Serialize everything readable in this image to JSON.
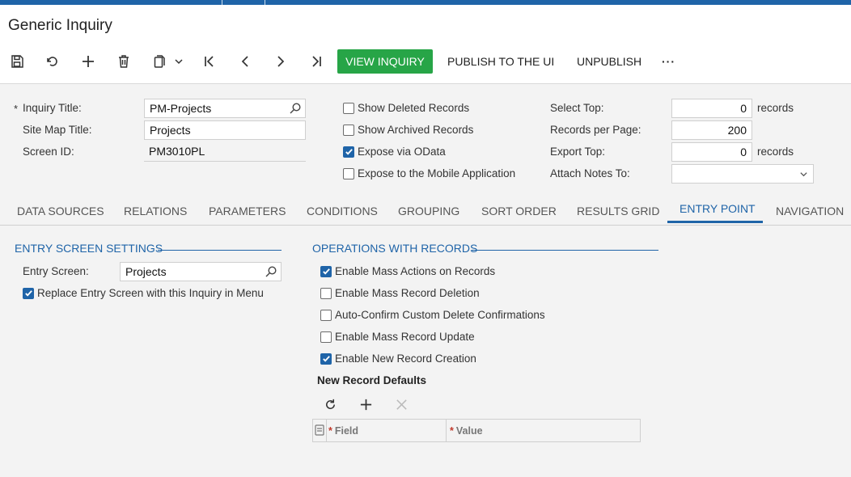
{
  "title": "Generic Inquiry",
  "toolbar": {
    "icons": [
      "save-icon",
      "undo-icon",
      "add-icon",
      "delete-icon",
      "copy-paste-icon",
      "first-record-icon",
      "previous-record-icon",
      "next-record-icon",
      "last-record-icon"
    ],
    "view_inquiry": "VIEW INQUIRY",
    "publish": "PUBLISH TO THE UI",
    "unpublish": "UNPUBLISH",
    "more": "···",
    "accent": "#27a547"
  },
  "form": {
    "required_mark": "*",
    "inquiry_title_label": "Inquiry Title:",
    "inquiry_title_value": "PM-Projects",
    "site_map_title_label": "Site Map Title:",
    "site_map_title_value": "Projects",
    "screen_id_label": "Screen ID:",
    "screen_id_value": "PM3010PL",
    "show_deleted": {
      "label": "Show Deleted Records",
      "checked": false
    },
    "show_archived": {
      "label": "Show Archived Records",
      "checked": false
    },
    "expose_odata": {
      "label": "Expose via OData",
      "checked": true
    },
    "expose_mobile": {
      "label": "Expose to the Mobile Application",
      "checked": false
    },
    "select_top_label": "Select Top:",
    "select_top_value": "0",
    "select_top_unit": "records",
    "records_per_page_label": "Records per Page:",
    "records_per_page_value": "200",
    "export_top_label": "Export Top:",
    "export_top_value": "0",
    "export_top_unit": "records",
    "attach_notes_label": "Attach Notes To:",
    "attach_notes_value": ""
  },
  "tabs": [
    "DATA SOURCES",
    "RELATIONS",
    "PARAMETERS",
    "CONDITIONS",
    "GROUPING",
    "SORT ORDER",
    "RESULTS GRID",
    "ENTRY POINT",
    "NAVIGATION"
  ],
  "active_tab": "ENTRY POINT",
  "entry_screen_settings": {
    "title": "ENTRY SCREEN SETTINGS",
    "entry_screen_label": "Entry Screen:",
    "entry_screen_value": "Projects",
    "replace_entry": {
      "label": "Replace Entry Screen with this Inquiry in Menu",
      "checked": true
    }
  },
  "operations": {
    "title": "OPERATIONS WITH RECORDS",
    "mass_actions": {
      "label": "Enable Mass Actions on Records",
      "checked": true
    },
    "mass_deletion": {
      "label": "Enable Mass Record Deletion",
      "checked": false
    },
    "auto_confirm": {
      "label": "Auto-Confirm Custom Delete Confirmations",
      "checked": false
    },
    "mass_update": {
      "label": "Enable Mass Record Update",
      "checked": false
    },
    "new_record": {
      "label": "Enable New Record Creation",
      "checked": true
    },
    "new_record_defaults": "New Record Defaults",
    "grid_columns": {
      "required_mark": "*",
      "field": "Field",
      "value": "Value"
    }
  },
  "colors": {
    "brand": "#1f64a8",
    "success": "#27a547"
  }
}
